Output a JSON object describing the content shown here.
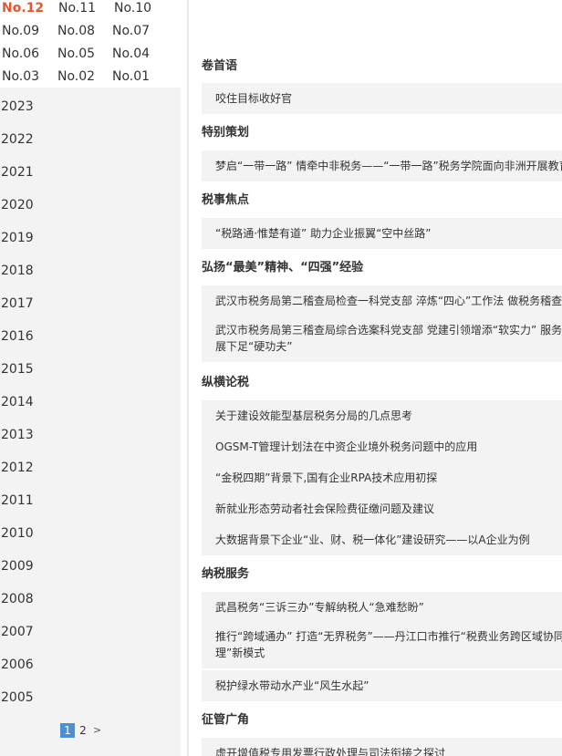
{
  "issues": [
    {
      "label": "No.12",
      "active": true
    },
    {
      "label": "No.11"
    },
    {
      "label": "No.10"
    },
    {
      "label": "No.09"
    },
    {
      "label": "No.08"
    },
    {
      "label": "No.07"
    },
    {
      "label": "No.06"
    },
    {
      "label": "No.05"
    },
    {
      "label": "No.04"
    },
    {
      "label": "No.03"
    },
    {
      "label": "No.02"
    },
    {
      "label": "No.01"
    }
  ],
  "years": [
    "2023",
    "2022",
    "2021",
    "2020",
    "2019",
    "2018",
    "2017",
    "2016",
    "2015",
    "2014",
    "2013",
    "2012",
    "2011",
    "2010",
    "2009",
    "2008",
    "2007",
    "2006",
    "2005"
  ],
  "pager": {
    "current": "1",
    "next_page": "2",
    "next_icon": ">"
  },
  "sections": [
    {
      "title": "卷首语",
      "articles": [
        "咬住目标收好官"
      ]
    },
    {
      "title": "特别策划",
      "articles": [
        "梦启“一带一路” 情牵中非税务——“一带一路”税务学院面向非洲开展教育"
      ]
    },
    {
      "title": "税事焦点",
      "articles": [
        "“税路通·惟楚有道” 助力企业振翼“空中丝路”"
      ]
    },
    {
      "title": "弘扬“最美”精神、“四强”经验",
      "articles": [
        "武汉市税务局第二稽查局检查一科党支部 淬炼“四心”工作法 做税务稽查”",
        "武汉市税务局第三稽查局综合选案科党支部 党建引领增添“软实力” 服务发展下足“硬功夫”"
      ]
    },
    {
      "title": "纵横论税",
      "articles": [
        "关于建设效能型基层税务分局的几点思考",
        "OGSM-T管理计划法在中资企业境外税务问题中的应用",
        "“金税四期”背景下,国有企业RPA技术应用初探",
        "新就业形态劳动者社会保险费征缴问题及建议",
        "大数据背景下企业“业、财、税一体化”建设研究——以A企业为例"
      ]
    },
    {
      "title": "纳税服务",
      "articles": [
        "武昌税务“三诉三办”专解纳税人“急难愁盼”",
        "推行“跨域通办” 打造“无界税务”——丹江口市推行“税费业务跨区域协同办理”新模式",
        "税护绿水带动水产业“风生水起”"
      ]
    },
    {
      "title": "征管广角",
      "articles": [
        "虚开增值税专用发票行政处理与司法衔接之探讨"
      ]
    }
  ],
  "colors": {
    "active_issue": "#e2582f",
    "pager_current_bg": "#4a90d9",
    "left_bg": "#f3f3f3",
    "article_bg": "#f3f3f3"
  }
}
